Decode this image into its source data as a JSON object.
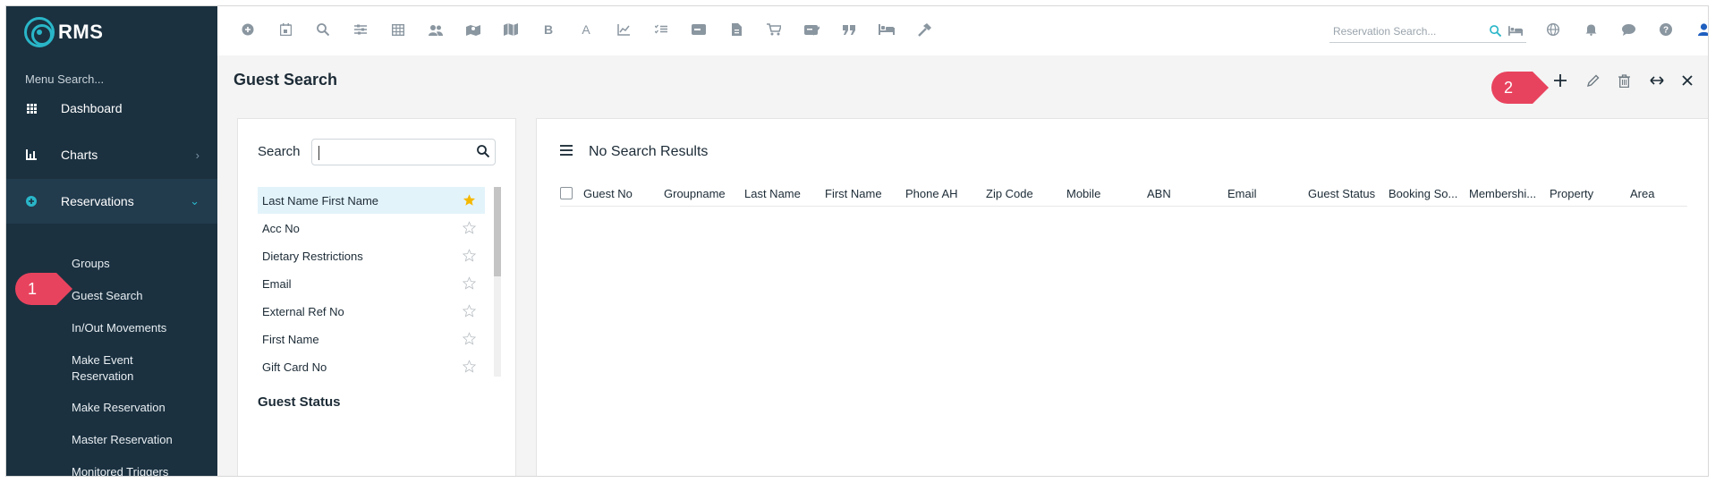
{
  "app": {
    "name": "RMS"
  },
  "sidebar": {
    "menu_search": "Menu Search...",
    "items": [
      {
        "label": "Dashboard",
        "icon": "grid-icon"
      },
      {
        "label": "Charts",
        "icon": "chart-icon"
      },
      {
        "label": "Reservations",
        "icon": "plus-circle-icon"
      }
    ],
    "reservations_sub": [
      "Groups",
      "Guest Search",
      "In/Out Movements",
      "Make Event Reservation",
      "Make Reservation",
      "Master Reservation",
      "Monitored Triggers"
    ]
  },
  "topbar": {
    "icons": [
      "plus-circle-icon",
      "calendar-icon",
      "search-icon",
      "sliders-icon",
      "table-icon",
      "users-icon",
      "map-pin-icon",
      "map-icon",
      "bold-b-icon",
      "font-a-icon",
      "line-chart-icon",
      "checklist-icon",
      "card-icon",
      "file-icon",
      "cart-icon",
      "tag-icon",
      "quote-icon",
      "bed-icon",
      "hammer-icon"
    ],
    "letter_b": "B",
    "letter_a": "A",
    "reservation_search_placeholder": "Reservation Search...",
    "right_icons": [
      "globe-icon",
      "bell-icon",
      "chat-icon",
      "help-icon",
      "user-icon"
    ]
  },
  "page": {
    "title": "Guest Search"
  },
  "callouts": {
    "one": "1",
    "two": "2"
  },
  "search_panel": {
    "label": "Search",
    "fields": [
      {
        "label": "Last Name First Name",
        "favorite": true
      },
      {
        "label": "Acc No",
        "favorite": false
      },
      {
        "label": "Dietary Restrictions",
        "favorite": false
      },
      {
        "label": "Email",
        "favorite": false
      },
      {
        "label": "External Ref No",
        "favorite": false
      },
      {
        "label": "First Name",
        "favorite": false
      },
      {
        "label": "Gift Card No",
        "favorite": false
      }
    ],
    "guest_status_heading": "Guest Status"
  },
  "results": {
    "title": "No Search Results",
    "columns": [
      "Guest No",
      "Groupname",
      "Last Name",
      "First Name",
      "Phone AH",
      "Zip Code",
      "Mobile",
      "ABN",
      "Email",
      "Guest Status",
      "Booking So...",
      "Membershi...",
      "Property",
      "Area"
    ]
  },
  "colors": {
    "sidebar": "#1b3140",
    "accent": "#29b6c8",
    "callout": "#e8435e",
    "star_active": "#f5b800"
  }
}
